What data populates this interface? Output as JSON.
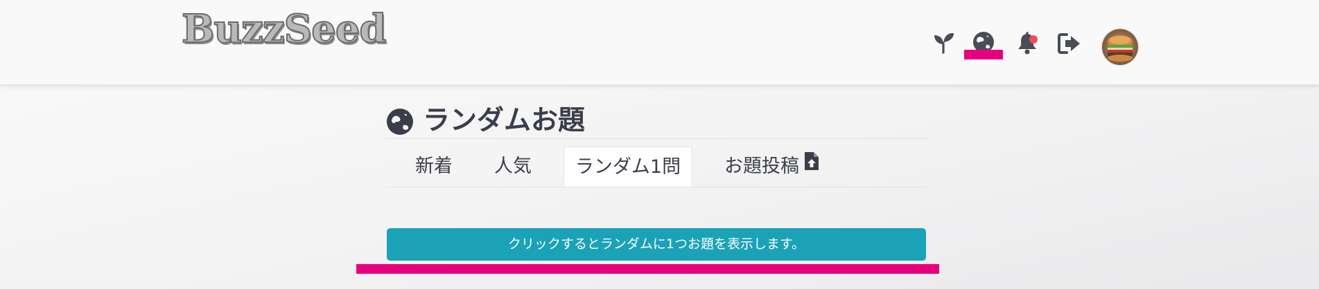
{
  "header": {
    "logo_text": "BuzzSeed",
    "icons": [
      {
        "name": "sprout-icon",
        "label": "seedling"
      },
      {
        "name": "globe-icon",
        "label": "random",
        "selected": true
      },
      {
        "name": "bell-icon",
        "label": "notifications",
        "has_unread": true
      },
      {
        "name": "sign-out-icon",
        "label": "logout"
      },
      {
        "name": "avatar",
        "label": "user avatar"
      }
    ],
    "highlight_color": "#e6007e",
    "notification_dot_color": "#ef4b5e"
  },
  "main": {
    "page_title": "ランダムお題",
    "page_title_icon": "globe-icon",
    "tabs": [
      {
        "label": "新着",
        "active": false
      },
      {
        "label": "人気",
        "active": false
      },
      {
        "label": "ランダム1問",
        "active": true
      },
      {
        "label": "お題投稿",
        "active": false,
        "icon": "file-upload-icon"
      }
    ],
    "random_button_label": "クリックするとランダムに1つお題を表示します。",
    "button_color": "#1ba2b7"
  }
}
